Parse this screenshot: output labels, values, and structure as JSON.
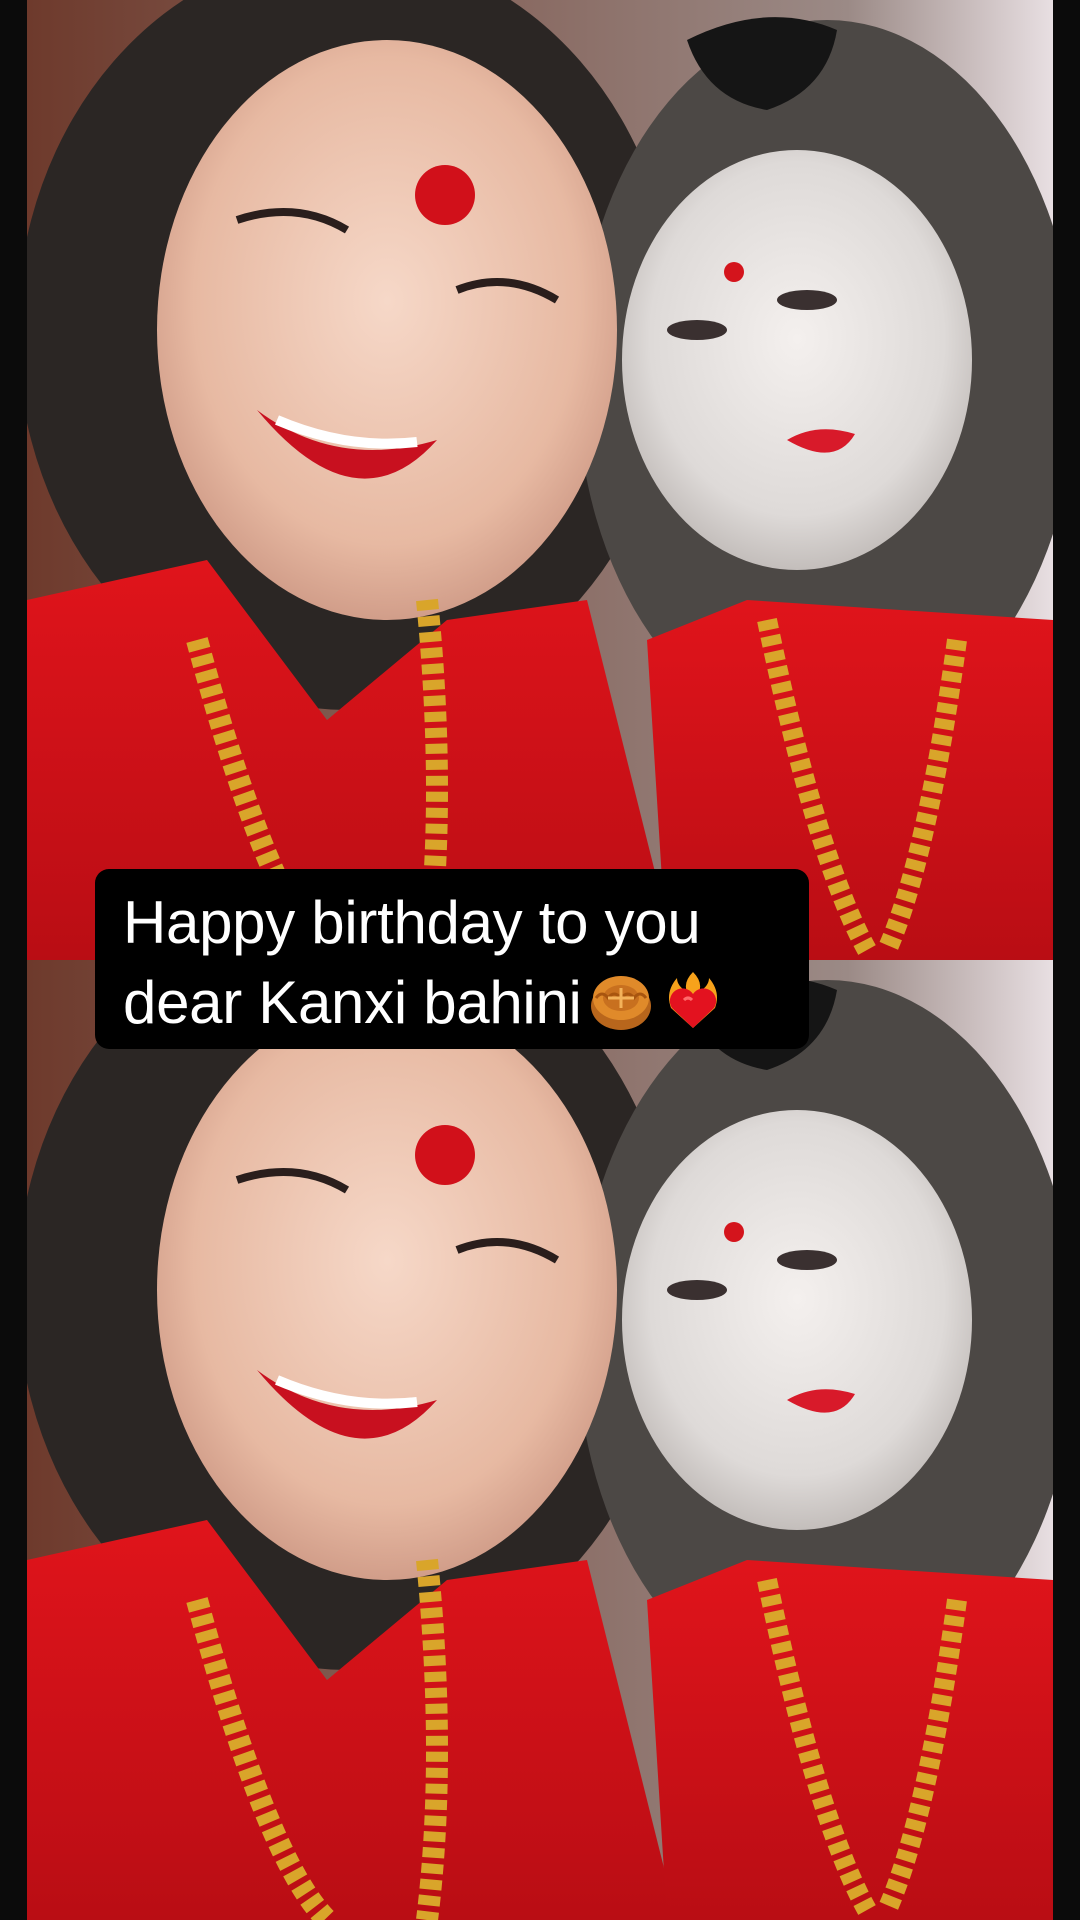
{
  "caption": {
    "line1": "Happy birthday to you",
    "line2": "dear Kanxi bahini"
  },
  "icons": [
    "mooncake-icon",
    "heart-on-fire-icon"
  ],
  "colors": {
    "background": "#0b0b0b",
    "saree_red": "#d4141c",
    "gold": "#d9a52a",
    "caption_bg": "#000000",
    "caption_text": "#ffffff"
  }
}
